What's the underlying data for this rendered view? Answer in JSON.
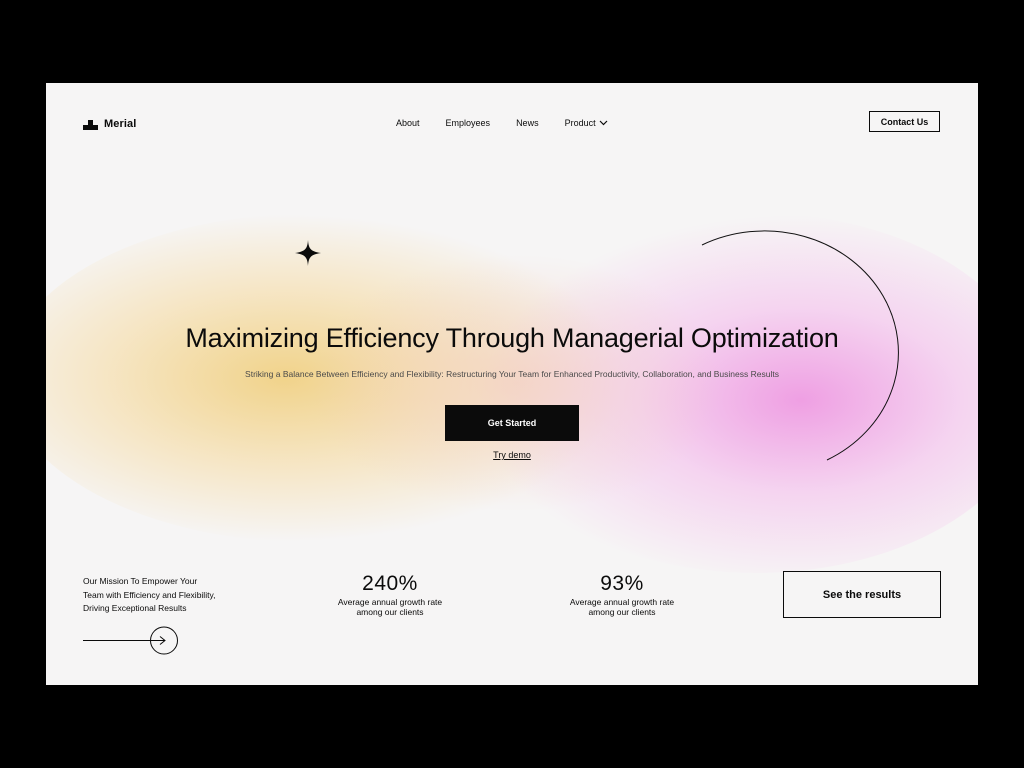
{
  "brand": {
    "name": "Merial",
    "logo_icon": "checker-blocks-icon"
  },
  "nav": {
    "items": [
      {
        "label": "About"
      },
      {
        "label": "Employees"
      },
      {
        "label": "News"
      },
      {
        "label": "Product",
        "icon": "chevron-down-icon"
      }
    ]
  },
  "header": {
    "contact_label": "Contact Us"
  },
  "hero": {
    "title": "Maximizing Efficiency Through Managerial Optimization",
    "subtitle": "Striking a Balance Between Efficiency and Flexibility: Restructuring Your Team for Enhanced Productivity, Collaboration, and Business Results",
    "cta_label": "Get Started",
    "demo_label": "Try demo"
  },
  "mission": {
    "lines": [
      "Our Mission To Empower Your",
      "Team with Efficiency and Flexibility,",
      "Driving Exceptional Results"
    ],
    "arrow_icon": "arrow-right-icon"
  },
  "stats": [
    {
      "value": "240%",
      "desc_line1": "Average annual growth rate",
      "desc_line2": "among our clients"
    },
    {
      "value": "93%",
      "desc_line1": "Average annual growth rate",
      "desc_line2": "among our clients"
    }
  ],
  "results_label": "See the results",
  "colors": {
    "background": "#000000",
    "page": "#f6f5f5",
    "text": "#0b0b0b",
    "glow_yellow": "#f0cd78",
    "glow_pink": "#ee96e1"
  }
}
